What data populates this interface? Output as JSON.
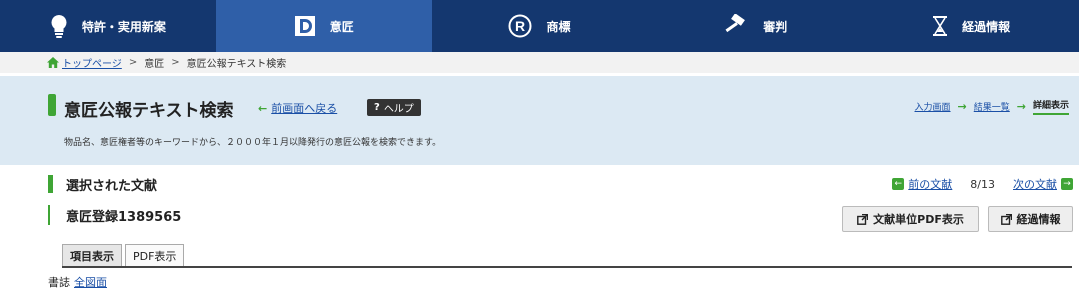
{
  "nav": {
    "items": [
      {
        "label": "特許・実用新案",
        "icon": "lightbulb-icon"
      },
      {
        "label": "意匠",
        "icon": "design-d-icon"
      },
      {
        "label": "商標",
        "icon": "registered-mark-icon"
      },
      {
        "label": "審判",
        "icon": "gavel-icon"
      },
      {
        "label": "経過情報",
        "icon": "hourglass-icon"
      }
    ],
    "active_index": 1
  },
  "breadcrumb": {
    "home": "トップページ",
    "sep": ">",
    "items": [
      "意匠",
      "意匠公報テキスト検索"
    ]
  },
  "header": {
    "title": "意匠公報テキスト検索",
    "back_label": "前画面へ戻る",
    "help_label": "ヘルプ",
    "help_mark": "?",
    "description": "物品名、意匠権者等のキーワードから、２０００年１月以降発行の意匠公報を検索できます。",
    "steps": [
      "入力画面",
      "結果一覧",
      "詳細表示"
    ]
  },
  "doc": {
    "selected_title": "選択された文献",
    "prev_label": "前の文献",
    "count": "8/13",
    "next_label": "次の文献",
    "registration": "意匠登録1389565",
    "pdf_button": "文献単位PDF表示",
    "progress_button": "経過情報"
  },
  "tabs": [
    "項目表示",
    "PDF表示"
  ],
  "biblio": {
    "label": "書誌",
    "link": "全図面"
  },
  "colors": {
    "nav_bg": "#14376f",
    "nav_active": "#2f5fa8",
    "band_bg": "#dce9f3",
    "accent_green": "#3fa535",
    "link": "#1a4fa6"
  }
}
